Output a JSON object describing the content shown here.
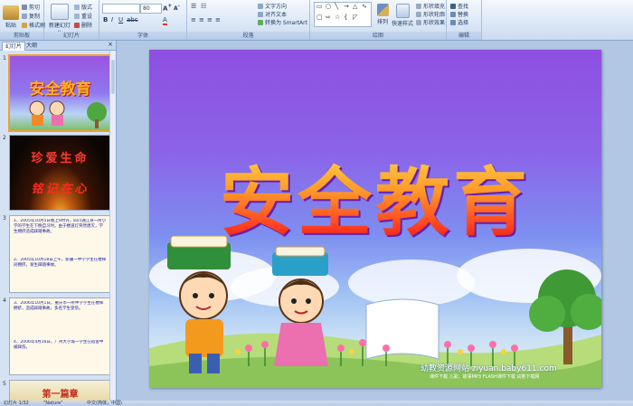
{
  "ribbon": {
    "groups": {
      "clipboard": "剪贴板",
      "slides": "幻灯片",
      "font": "字体",
      "paragraph": "段落",
      "drawing": "绘图",
      "editing": "编辑"
    },
    "paste": "粘贴",
    "cut": "剪切",
    "copy": "复制",
    "format_painter": "格式刷",
    "new_slide": "新建幻灯片",
    "layout": "版式",
    "reset": "重设",
    "delete": "删除",
    "font_size": "80",
    "text_direction": "文字方向",
    "align_text": "对齐文本",
    "convert_smartart": "转换为 SmartArt",
    "arrange": "排列",
    "quick_styles": "快速样式",
    "shape_fill": "形状填充",
    "shape_outline": "形状轮廓",
    "shape_effects": "形状效果",
    "find": "查找",
    "replace": "替换",
    "select": "选择"
  },
  "left_pane": {
    "tab_slides": "幻灯片",
    "tab_outline": "大纲",
    "close": "×",
    "thumbnails": [
      {
        "num": "1",
        "title": "安全教育"
      },
      {
        "num": "2",
        "title": "铭记在心",
        "headline": "珍爱生命"
      },
      {
        "num": "3",
        "bullets": [
          "1、2005年10月5日晚上9时许，四川通江县一所小学的学生在下晚自习时，由于楼道灯突然熄灭，学生拥挤造成踩踏事故。",
          "2、2005年10月18日上午，新疆一中学学生在楼梯间拥挤，发生踩踏事故。"
        ]
      },
      {
        "num": "4",
        "bullets": [
          "3、2006年10月1日，重庆市一所中学学生在楼梯拥挤，造成踩踏事故，多名学生受伤。",
          "4、2006年4月16日，广州大学城一学生在宿舍中被踩伤。"
        ]
      },
      {
        "num": "5",
        "title": "第一篇章"
      }
    ]
  },
  "slide": {
    "title": "安全教育",
    "watermark": "幼教资源网站 ziyuan.baby611.com",
    "watermark_sub": "课件下载  儿歌、故事MP3  FLASH课件下载  试卷下载网"
  },
  "status": {
    "slide_counter": "幻灯片 1/32",
    "theme": "\"Nature\"",
    "language": "中文(简体，中国)"
  },
  "colors": {
    "ribbon_bg": "#dbe7f6",
    "title_top": "#ffe34a",
    "title_bottom": "#c51515",
    "selection": "#f0a030"
  }
}
